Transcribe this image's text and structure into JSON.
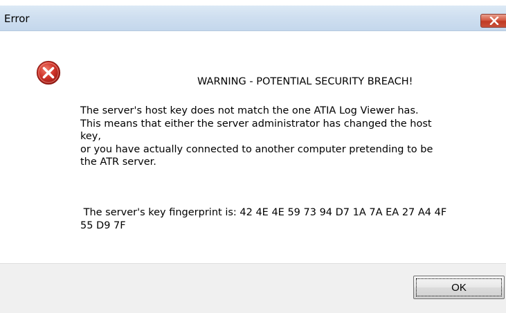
{
  "window": {
    "title": "Error",
    "close_icon": "close-x-icon"
  },
  "dialog": {
    "icon": "error-icon",
    "heading": "WARNING - POTENTIAL SECURITY BREACH!",
    "message_lines": [
      "The server's host key does not match the one ATIA Log Viewer has.",
      "This means that either the server administrator has changed the host",
      "key,",
      "or you have actually connected to another computer pretending to be",
      "the ATR server."
    ],
    "fingerprint_lines": [
      " The server's key fingerprint is: 42 4E 4E 59 73 94 D7 1A 7A EA 27 A4 4F",
      "55 D9 7F"
    ]
  },
  "buttons": {
    "ok_label": "OK"
  }
}
